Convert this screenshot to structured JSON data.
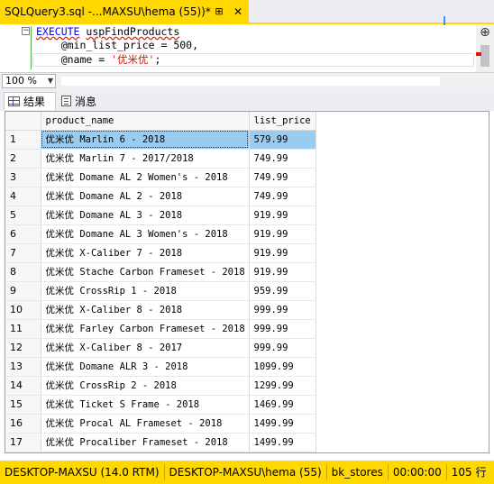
{
  "tab": {
    "title": "SQLQuery3.sql -...MAXSU\\hema (55))*",
    "pin_glyph": "⊞",
    "close_glyph": "✕"
  },
  "editor": {
    "line1_keyword": "EXECUTE",
    "line1_proc": "uspFindProducts",
    "line2": "    @min_list_price = 500,",
    "line3_param": "    @name = ",
    "line3_string": "'优米优'",
    "line3_end": ";"
  },
  "zoom": {
    "value": "100 %"
  },
  "results_tabs": [
    {
      "label": "结果",
      "icon": "grid-icon"
    },
    {
      "label": "消息",
      "icon": "message-icon"
    }
  ],
  "grid": {
    "columns": [
      "product_name",
      "list_price"
    ],
    "rows": [
      {
        "n": "1",
        "name": "优米优 Marlin 6 - 2018",
        "price": "579.99"
      },
      {
        "n": "2",
        "name": "优米优 Marlin 7 - 2017/2018",
        "price": "749.99"
      },
      {
        "n": "3",
        "name": "优米优 Domane AL 2 Women's - 2018",
        "price": "749.99"
      },
      {
        "n": "4",
        "name": "优米优 Domane AL 2 - 2018",
        "price": "749.99"
      },
      {
        "n": "5",
        "name": "优米优 Domane AL 3 - 2018",
        "price": "919.99"
      },
      {
        "n": "6",
        "name": "优米优 Domane AL 3 Women's - 2018",
        "price": "919.99"
      },
      {
        "n": "7",
        "name": "优米优 X-Caliber 7 - 2018",
        "price": "919.99"
      },
      {
        "n": "8",
        "name": "优米优 Stache Carbon Frameset - 2018",
        "price": "919.99"
      },
      {
        "n": "9",
        "name": "优米优 CrossRip 1 - 2018",
        "price": "959.99"
      },
      {
        "n": "10",
        "name": "优米优 X-Caliber 8 - 2018",
        "price": "999.99"
      },
      {
        "n": "11",
        "name": "优米优 Farley Carbon Frameset - 2018",
        "price": "999.99"
      },
      {
        "n": "12",
        "name": "优米优 X-Caliber 8 - 2017",
        "price": "999.99"
      },
      {
        "n": "13",
        "name": "优米优 Domane ALR 3 - 2018",
        "price": "1099.99"
      },
      {
        "n": "14",
        "name": "优米优 CrossRip 2 - 2018",
        "price": "1299.99"
      },
      {
        "n": "15",
        "name": "优米优 Ticket S Frame - 2018",
        "price": "1469.99"
      },
      {
        "n": "16",
        "name": "优米优 Procal AL Frameset - 2018",
        "price": "1499.99"
      },
      {
        "n": "17",
        "name": "优米优 Procaliber Frameset - 2018",
        "price": "1499.99"
      }
    ]
  },
  "status": {
    "server": "DESKTOP-MAXSU (14.0 RTM)",
    "user": "DESKTOP-MAXSU\\hema (55)",
    "database": "bk_stores",
    "elapsed": "00:00:00",
    "rows": "105 行"
  },
  "colors": {
    "accent": "#ffd800",
    "selection": "#99ccf0",
    "keyword": "#0000ff",
    "string": "#e51400"
  }
}
